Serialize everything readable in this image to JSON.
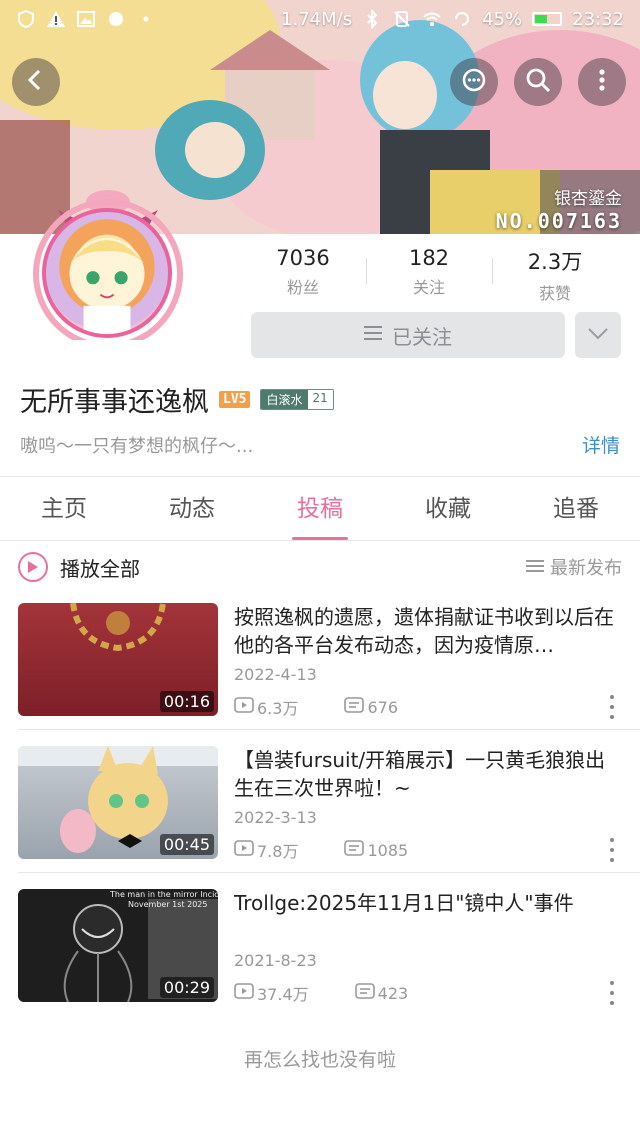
{
  "status_bar": {
    "speed": "1.74M/s",
    "battery": "45%",
    "time": "23:32"
  },
  "header": {
    "medal_name": "银杏鎏金",
    "medal_no": "NO.007163"
  },
  "stats": [
    {
      "value": "7036",
      "label": "粉丝"
    },
    {
      "value": "182",
      "label": "关注"
    },
    {
      "value": "2.3万",
      "label": "获赞"
    }
  ],
  "follow": {
    "label": "已关注"
  },
  "profile": {
    "name": "无所事事还逸枫",
    "level": "LV5",
    "fan_badge_name": "白滚水",
    "fan_badge_level": "21",
    "signature": "嗷呜～一只有梦想的枫仔～...",
    "detail_label": "详情"
  },
  "tabs": [
    {
      "label": "主页",
      "active": false
    },
    {
      "label": "动态",
      "active": false
    },
    {
      "label": "投稿",
      "active": true
    },
    {
      "label": "收藏",
      "active": false
    },
    {
      "label": "追番",
      "active": false
    }
  ],
  "play_all": {
    "label": "播放全部",
    "sort_label": "最新发布"
  },
  "videos": [
    {
      "title": "按照逸枫的遗愿，遗体捐献证书收到以后在他的各平台发布动态，因为疫情原…",
      "date": "2022-4-13",
      "views": "6.3万",
      "comments": "676",
      "duration": "00:16"
    },
    {
      "title": "【兽装fursuit/开箱展示】一只黄毛狼狼出生在三次世界啦！~",
      "date": "2022-3-13",
      "views": "7.8万",
      "comments": "1085",
      "duration": "00:45"
    },
    {
      "title": "Trollge:2025年11月1日\"镜中人\"事件",
      "date": "2021-8-23",
      "views": "37.4万",
      "comments": "423",
      "duration": "00:29",
      "thumb_caption_1": "The man in the mirror Incident",
      "thumb_caption_2": "November 1st 2025"
    }
  ],
  "end_text": "再怎么找也没有啦",
  "colors": {
    "accent": "#e8719c",
    "link": "#3d8fc6",
    "level_badge": "#f29f4a",
    "fan_badge": "#4f7a6e"
  }
}
